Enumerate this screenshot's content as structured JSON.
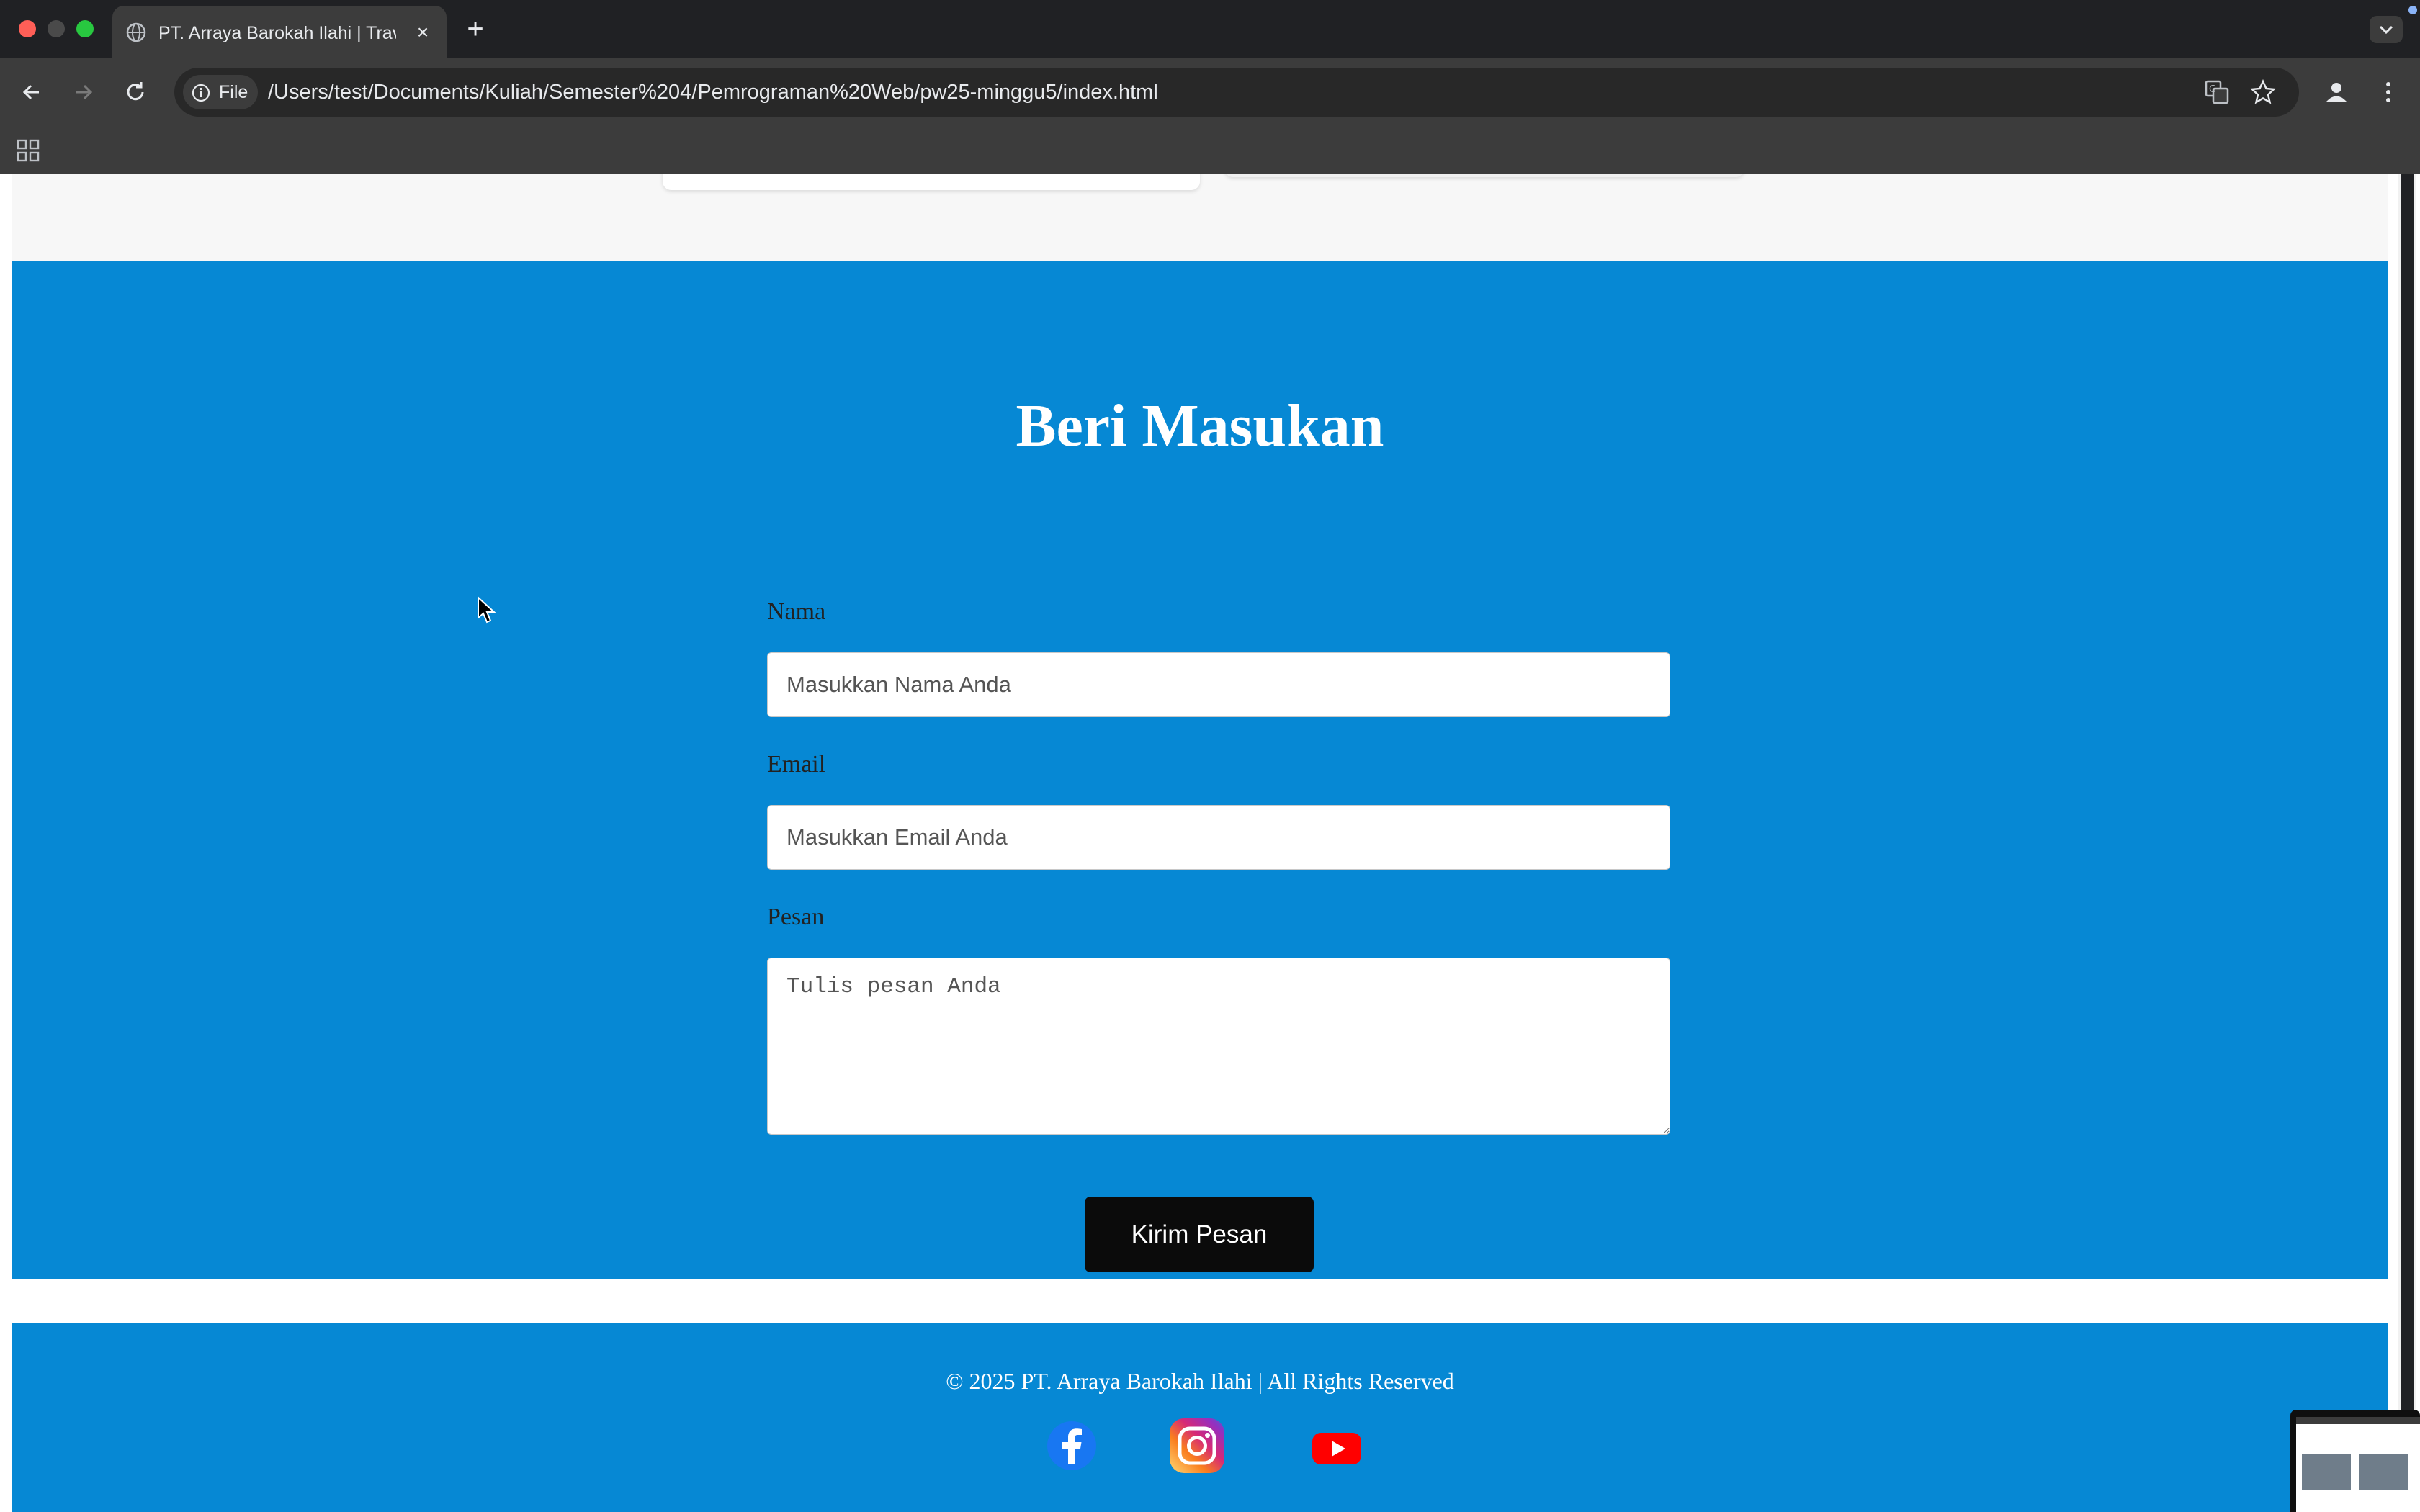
{
  "browser": {
    "tab_title": "PT. Arraya Barokah Ilahi | Travel",
    "new_tab_symbol": "+",
    "close_symbol": "×",
    "chip_label": "File",
    "url": "/Users/test/Documents/Kuliah/Semester%204/Pemrograman%20Web/pw25-minggu5/index.html",
    "icons": [
      "back-icon",
      "forward-icon",
      "reload-icon",
      "info-icon",
      "translate-icon",
      "star-icon",
      "profile-icon",
      "menu-icon",
      "apps-icon",
      "tab-search-icon"
    ]
  },
  "feedback": {
    "title": "Beri Masukan",
    "name_label": "Nama",
    "name_placeholder": "Masukkan Nama Anda",
    "email_label": "Email",
    "email_placeholder": "Masukkan Email Anda",
    "message_label": "Pesan",
    "message_placeholder": "Tulis pesan Anda",
    "submit_label": "Kirim Pesan"
  },
  "footer": {
    "copyright": "© 2025 PT. Arraya Barokah Ilahi | All Rights Reserved",
    "social": [
      "facebook-icon",
      "instagram-icon",
      "youtube-icon"
    ]
  },
  "colors": {
    "section_blue": "#0688d4",
    "button_black": "#0b0b0b",
    "chrome_dark": "#202124",
    "chrome_toolbar": "#3c3c3c"
  }
}
